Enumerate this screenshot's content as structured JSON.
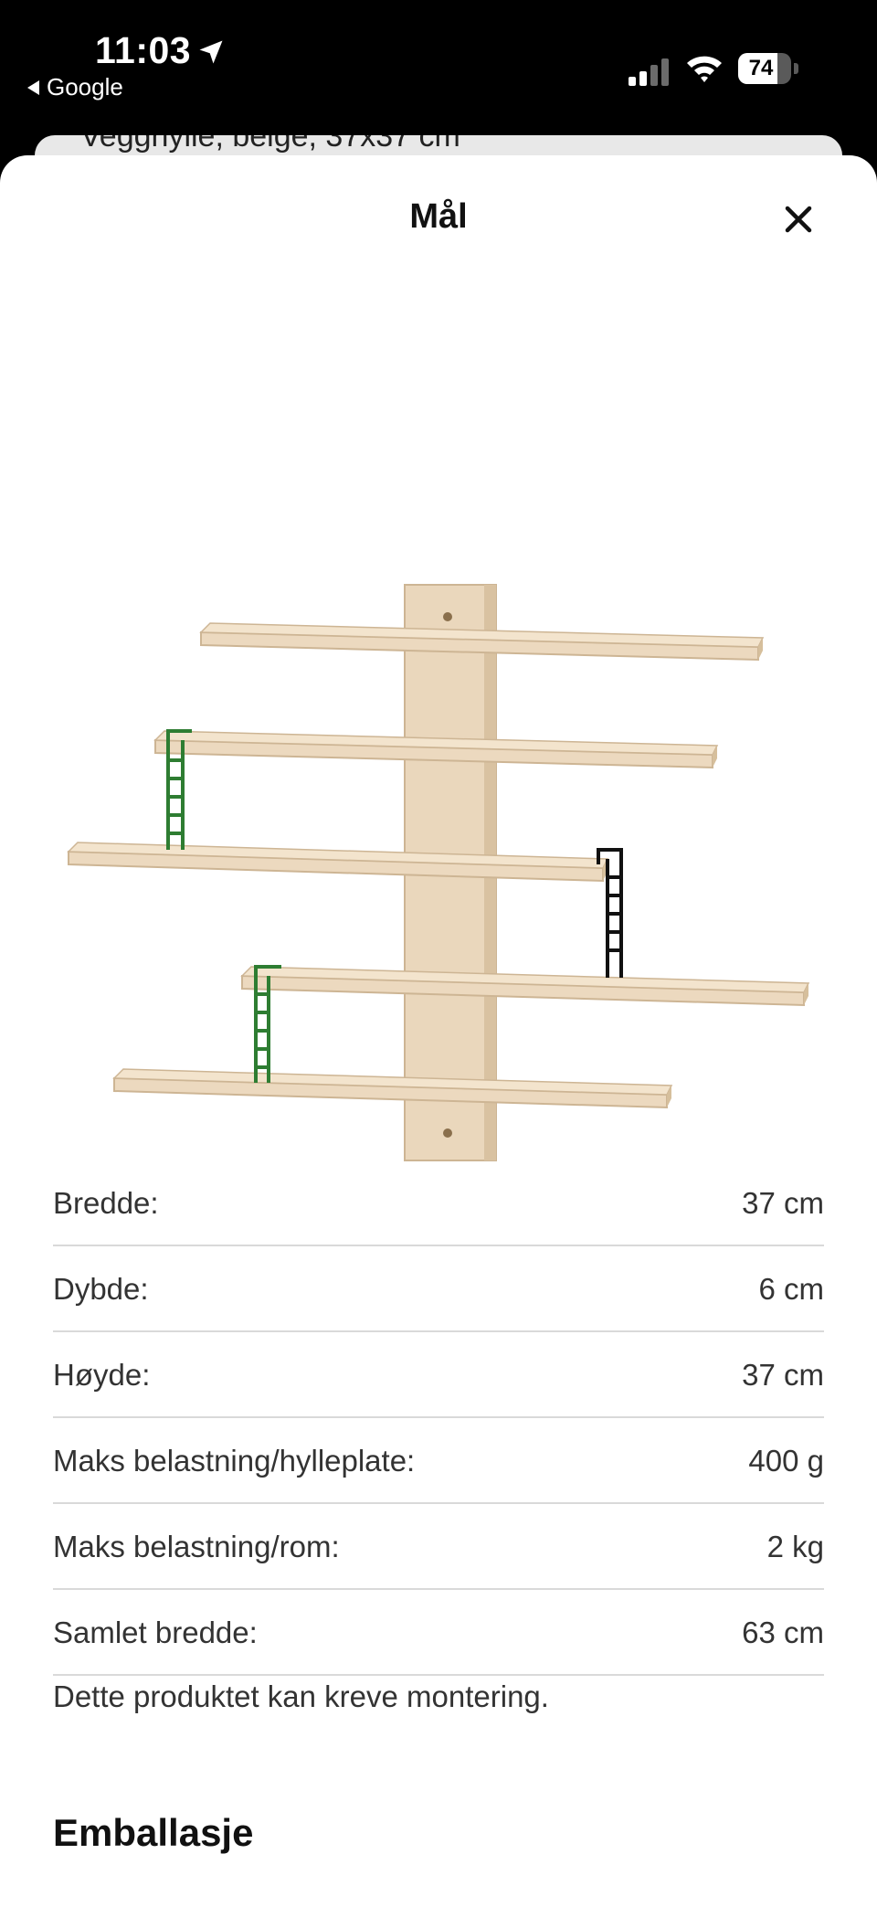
{
  "status_bar": {
    "time": "11:03",
    "back_app": "Google",
    "battery_percent": "74",
    "battery_level": 0.74
  },
  "peek": {
    "text": "Vegghylle, beige, 37x37 cm"
  },
  "sheet": {
    "title": "Mål",
    "close_icon": "close-icon"
  },
  "specs": [
    {
      "label": "Bredde:",
      "value": "37 cm"
    },
    {
      "label": "Dybde:",
      "value": "6 cm"
    },
    {
      "label": "Høyde:",
      "value": "37 cm"
    },
    {
      "label": "Maks belastning/hylleplate:",
      "value": "400 g"
    },
    {
      "label": "Maks belastning/rom:",
      "value": "2 kg"
    },
    {
      "label": "Samlet bredde:",
      "value": "63 cm"
    }
  ],
  "note": "Dette produktet kan kreve montering.",
  "section_heading": "Emballasje",
  "colors": {
    "wood": "#ecd9bf",
    "wood_edge": "#d8c3a3",
    "ladder_green": "#2e7d32",
    "ladder_black": "#111111"
  }
}
